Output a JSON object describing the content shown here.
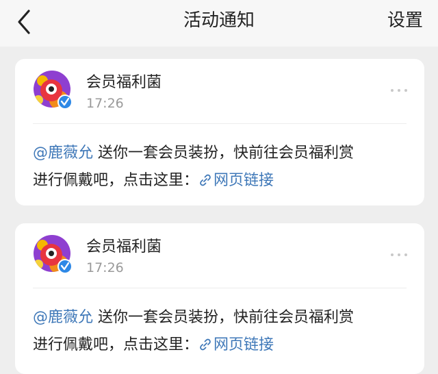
{
  "header": {
    "title": "活动通知",
    "settings_label": "设置",
    "back_icon": "chevron-left-icon"
  },
  "notifications": [
    {
      "sender": "会员福利菌",
      "time": "17:26",
      "mention": "@鹿薇允",
      "text_line1": " 送你一套会员装扮，快前往会员福利赏",
      "text_line2": "进行佩戴吧，点击这里：",
      "link_label": "网页链接",
      "verified": true
    },
    {
      "sender": "会员福利菌",
      "time": "17:26",
      "mention": "@鹿薇允",
      "text_line1": " 送你一套会员装扮，快前往会员福利赏",
      "text_line2": "进行佩戴吧，点击这里：",
      "link_label": "网页链接",
      "verified": true
    }
  ],
  "colors": {
    "accent": "#3f78b8",
    "background": "#eeeeee",
    "card": "#ffffff",
    "muted": "#999999"
  }
}
